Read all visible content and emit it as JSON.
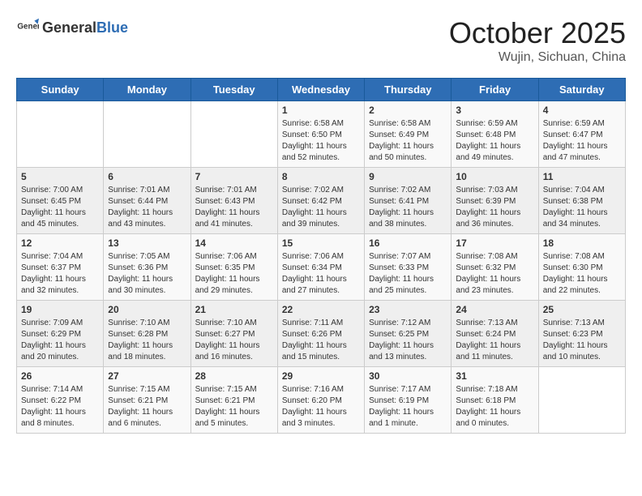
{
  "header": {
    "logo_general": "General",
    "logo_blue": "Blue",
    "month": "October 2025",
    "location": "Wujin, Sichuan, China"
  },
  "weekdays": [
    "Sunday",
    "Monday",
    "Tuesday",
    "Wednesday",
    "Thursday",
    "Friday",
    "Saturday"
  ],
  "weeks": [
    [
      {
        "day": "",
        "info": ""
      },
      {
        "day": "",
        "info": ""
      },
      {
        "day": "",
        "info": ""
      },
      {
        "day": "1",
        "info": "Sunrise: 6:58 AM\nSunset: 6:50 PM\nDaylight: 11 hours\nand 52 minutes."
      },
      {
        "day": "2",
        "info": "Sunrise: 6:58 AM\nSunset: 6:49 PM\nDaylight: 11 hours\nand 50 minutes."
      },
      {
        "day": "3",
        "info": "Sunrise: 6:59 AM\nSunset: 6:48 PM\nDaylight: 11 hours\nand 49 minutes."
      },
      {
        "day": "4",
        "info": "Sunrise: 6:59 AM\nSunset: 6:47 PM\nDaylight: 11 hours\nand 47 minutes."
      }
    ],
    [
      {
        "day": "5",
        "info": "Sunrise: 7:00 AM\nSunset: 6:45 PM\nDaylight: 11 hours\nand 45 minutes."
      },
      {
        "day": "6",
        "info": "Sunrise: 7:01 AM\nSunset: 6:44 PM\nDaylight: 11 hours\nand 43 minutes."
      },
      {
        "day": "7",
        "info": "Sunrise: 7:01 AM\nSunset: 6:43 PM\nDaylight: 11 hours\nand 41 minutes."
      },
      {
        "day": "8",
        "info": "Sunrise: 7:02 AM\nSunset: 6:42 PM\nDaylight: 11 hours\nand 39 minutes."
      },
      {
        "day": "9",
        "info": "Sunrise: 7:02 AM\nSunset: 6:41 PM\nDaylight: 11 hours\nand 38 minutes."
      },
      {
        "day": "10",
        "info": "Sunrise: 7:03 AM\nSunset: 6:39 PM\nDaylight: 11 hours\nand 36 minutes."
      },
      {
        "day": "11",
        "info": "Sunrise: 7:04 AM\nSunset: 6:38 PM\nDaylight: 11 hours\nand 34 minutes."
      }
    ],
    [
      {
        "day": "12",
        "info": "Sunrise: 7:04 AM\nSunset: 6:37 PM\nDaylight: 11 hours\nand 32 minutes."
      },
      {
        "day": "13",
        "info": "Sunrise: 7:05 AM\nSunset: 6:36 PM\nDaylight: 11 hours\nand 30 minutes."
      },
      {
        "day": "14",
        "info": "Sunrise: 7:06 AM\nSunset: 6:35 PM\nDaylight: 11 hours\nand 29 minutes."
      },
      {
        "day": "15",
        "info": "Sunrise: 7:06 AM\nSunset: 6:34 PM\nDaylight: 11 hours\nand 27 minutes."
      },
      {
        "day": "16",
        "info": "Sunrise: 7:07 AM\nSunset: 6:33 PM\nDaylight: 11 hours\nand 25 minutes."
      },
      {
        "day": "17",
        "info": "Sunrise: 7:08 AM\nSunset: 6:32 PM\nDaylight: 11 hours\nand 23 minutes."
      },
      {
        "day": "18",
        "info": "Sunrise: 7:08 AM\nSunset: 6:30 PM\nDaylight: 11 hours\nand 22 minutes."
      }
    ],
    [
      {
        "day": "19",
        "info": "Sunrise: 7:09 AM\nSunset: 6:29 PM\nDaylight: 11 hours\nand 20 minutes."
      },
      {
        "day": "20",
        "info": "Sunrise: 7:10 AM\nSunset: 6:28 PM\nDaylight: 11 hours\nand 18 minutes."
      },
      {
        "day": "21",
        "info": "Sunrise: 7:10 AM\nSunset: 6:27 PM\nDaylight: 11 hours\nand 16 minutes."
      },
      {
        "day": "22",
        "info": "Sunrise: 7:11 AM\nSunset: 6:26 PM\nDaylight: 11 hours\nand 15 minutes."
      },
      {
        "day": "23",
        "info": "Sunrise: 7:12 AM\nSunset: 6:25 PM\nDaylight: 11 hours\nand 13 minutes."
      },
      {
        "day": "24",
        "info": "Sunrise: 7:13 AM\nSunset: 6:24 PM\nDaylight: 11 hours\nand 11 minutes."
      },
      {
        "day": "25",
        "info": "Sunrise: 7:13 AM\nSunset: 6:23 PM\nDaylight: 11 hours\nand 10 minutes."
      }
    ],
    [
      {
        "day": "26",
        "info": "Sunrise: 7:14 AM\nSunset: 6:22 PM\nDaylight: 11 hours\nand 8 minutes."
      },
      {
        "day": "27",
        "info": "Sunrise: 7:15 AM\nSunset: 6:21 PM\nDaylight: 11 hours\nand 6 minutes."
      },
      {
        "day": "28",
        "info": "Sunrise: 7:15 AM\nSunset: 6:21 PM\nDaylight: 11 hours\nand 5 minutes."
      },
      {
        "day": "29",
        "info": "Sunrise: 7:16 AM\nSunset: 6:20 PM\nDaylight: 11 hours\nand 3 minutes."
      },
      {
        "day": "30",
        "info": "Sunrise: 7:17 AM\nSunset: 6:19 PM\nDaylight: 11 hours\nand 1 minute."
      },
      {
        "day": "31",
        "info": "Sunrise: 7:18 AM\nSunset: 6:18 PM\nDaylight: 11 hours\nand 0 minutes."
      },
      {
        "day": "",
        "info": ""
      }
    ]
  ]
}
